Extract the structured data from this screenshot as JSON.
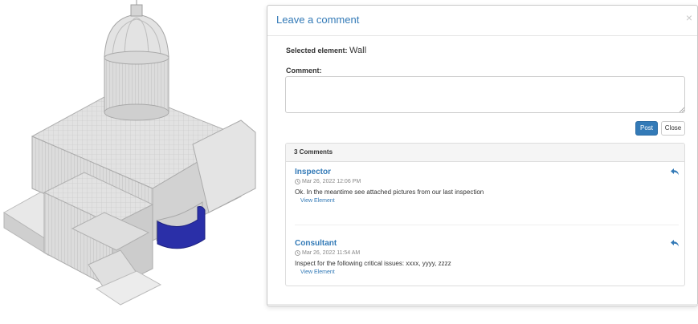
{
  "modal": {
    "title": "Leave a comment",
    "close_symbol": "×",
    "selected_label": "Selected element:",
    "selected_value": "Wall",
    "comment_label": "Comment:",
    "comment_value": "",
    "post_label": "Post",
    "close_label": "Close",
    "comments_heading": "3 Comments",
    "comments": [
      {
        "author": "Inspector",
        "timestamp": "Mar 26, 2022 12:06 PM",
        "text": "Ok. In the meantime see attached pictures from our last inspection",
        "link": "View Element"
      },
      {
        "author": "Consultant",
        "timestamp": "Mar 26, 2022 11:54 AM",
        "text": "Inspect for the following critical issues: xxxx, yyyy, zzzz",
        "link": "View Element"
      }
    ]
  },
  "icons": {
    "close": "close-icon",
    "reply": "reply-icon",
    "clock": "clock-icon",
    "resize": "resize-grip-icon"
  },
  "colors": {
    "accent": "#337ab7",
    "highlight_wall": "#2a2fa8",
    "model_gray": "#d8d8d8"
  }
}
